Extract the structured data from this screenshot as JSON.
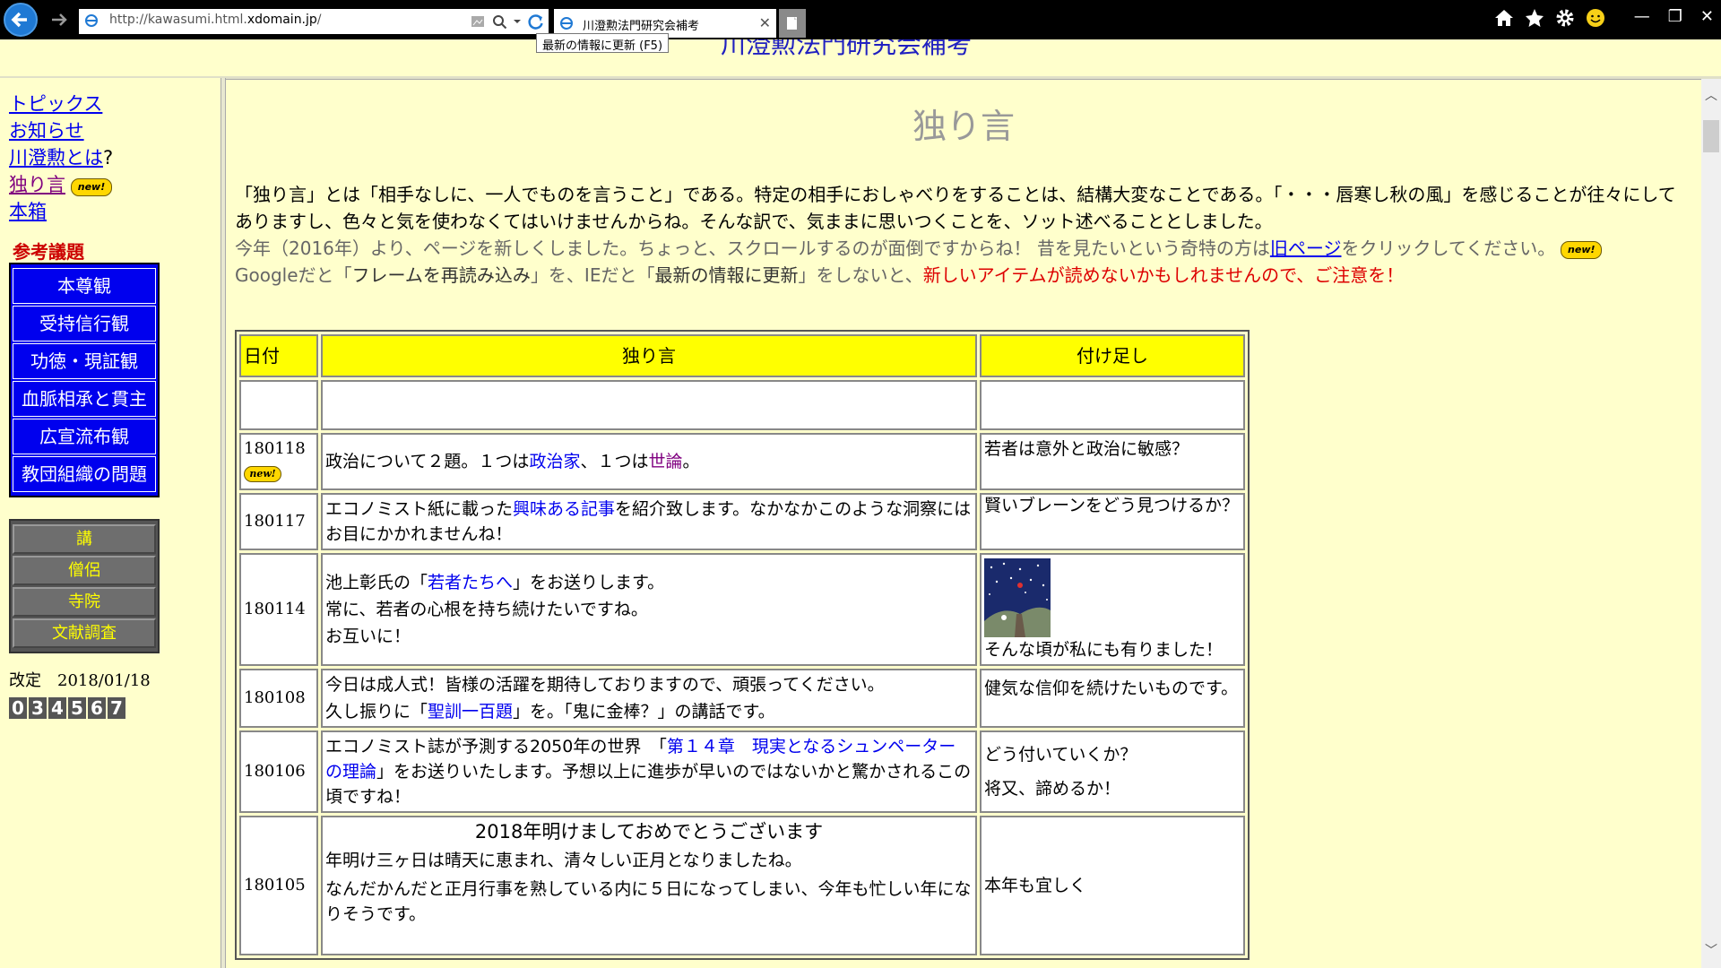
{
  "browser": {
    "url_prefix": "http://kawasumi.html.",
    "url_domain": "xdomain.jp",
    "url_suffix": "/",
    "tab_title": "川澄勲法門研究会補考",
    "tooltip": "最新の情報に更新 (F5)"
  },
  "site": {
    "title": "川澄勲法門研究会補考"
  },
  "nav": {
    "links": [
      "トピックス",
      "お知らせ",
      "川澄勲とは",
      "独り言",
      "本箱"
    ],
    "question_mark": "?",
    "new_badge": "new!",
    "section_heading": "参考議題",
    "blue_menu": [
      "本尊観",
      "受持信行観",
      "功徳・現証観",
      "血脈相承と貫主",
      "広宣流布観",
      "教団組織の問題"
    ],
    "gray_menu": [
      "講",
      "僧侶",
      "寺院",
      "文献調査"
    ],
    "revised_label": "改定",
    "revised_date": "2018/01/18",
    "counter": [
      "0",
      "3",
      "4",
      "5",
      "6",
      "7"
    ]
  },
  "main": {
    "heading": "独り言",
    "intro_1": "「独り言」とは「相手なしに、一人でものを言うこと」である。特定の相手におしゃべりをすることは、結構大変なことである。「・・・唇寒し秋の風」を感じることが往々にしてありますし、色々と気を使わなくてはいけませんからね。そんな訳で、気ままに思いつくことを、ソット述べることとしました。",
    "intro_2a": "今年（2016年）より、ページを新しくしました。ちょっと、スクロールするのが面倒ですからね！ 昔を見たいという奇特の方は",
    "intro_2_link": "旧ページ",
    "intro_2b": "をクリックしてください。",
    "intro_3a": "Googleだと「",
    "intro_3b": "フレームを再読み込み",
    "intro_3c": "」を、IEだと「",
    "intro_3d": "最新の情報に更新",
    "intro_3e": "」をしないと、",
    "intro_3f": "新しいアイテムが読めないかもしれませんので、ご注意を！",
    "table_headers": [
      "日付",
      "独り言",
      "付け足し"
    ],
    "rows": {
      "r180118": {
        "date": "180118",
        "text_a": "政治について２題。１つは",
        "link1": "政治家",
        "text_b": "、１つは",
        "link2": "世論",
        "text_c": "。",
        "note": "若者は意外と政治に敏感？"
      },
      "r180117": {
        "date": "180117",
        "text_a": "エコノミスト紙に載った",
        "link": "興味ある記事",
        "text_b": "を紹介致します。なかなかこのような洞察にはお目にかかれませんね！",
        "note": "賢いブレーンをどう見つけるか？"
      },
      "r180114": {
        "date": "180114",
        "line1a": "池上彰氏の「",
        "link": "若者たちへ",
        "line1b": "」をお送りします。",
        "line2": "常に、若者の心根を持ち続けたいですね。",
        "line3": "お互いに！",
        "note": "そんな頃が私にも有りました！"
      },
      "r180108": {
        "date": "180108",
        "line1": "今日は成人式！皆様の活躍を期待しておりますので、頑張ってください。",
        "line2a": "久し振りに「",
        "link": "聖訓一百題",
        "line2b": "」を。「鬼に金棒？」の講話です。",
        "note": "健気な信仰を続けたいものです。"
      },
      "r180106": {
        "date": "180106",
        "text_a": "エコノミスト誌が予測する2050年の世界　「",
        "link": "第１４章　現実となるシュンペーターの理論",
        "text_b": "」をお送りいたします。予想以上に進歩が早いのではないかと驚かされるこの頃ですね！",
        "note1": "どう付いていくか？",
        "note2": "将又、諦めるか！"
      },
      "r180105": {
        "date": "180105",
        "title": "2018年明けましておめでとうございます",
        "line1": "年明け三ヶ日は晴天に恵まれ、清々しい正月となりましたね。",
        "line2": "なんだかんだと正月行事を熟している内に５日になってしまい、今年も忙しい年になりそうです。",
        "note": "本年も宜しく"
      }
    }
  }
}
